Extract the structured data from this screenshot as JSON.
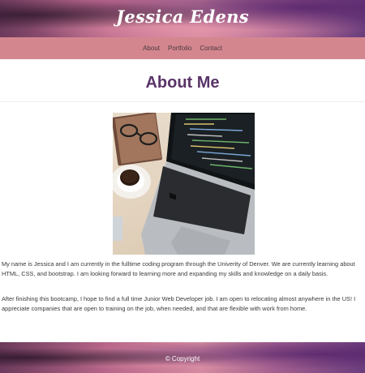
{
  "site": {
    "brand": "Jessica Edens"
  },
  "nav": {
    "items": [
      {
        "label": "About"
      },
      {
        "label": "Portfolio"
      },
      {
        "label": "Contact"
      }
    ]
  },
  "main": {
    "title": "About Me",
    "photo_icon": "laptop-desk-photo",
    "paragraphs": [
      "My name is Jessica and I am currently in the fulltime coding program through the Univerity of Denver. We are currently learning about HTML, CSS, and bootstrap. I am looking forward to learning more and expanding my skills and knowledge on a daily basis.",
      "After finishing this bootcamp, I hope to find a full time Junior Web Developer job. I am open to relocating almost anywhere in the US! I appreciate companies that are open to training on the job, when needed, and that are flexible with work from home."
    ]
  },
  "footer": {
    "copyright": "© Copyright"
  },
  "colors": {
    "navbar": "#d4868f",
    "title": "#5a3468",
    "hero_pink": "#d48aa0",
    "hero_purple": "#6a3d7d"
  }
}
